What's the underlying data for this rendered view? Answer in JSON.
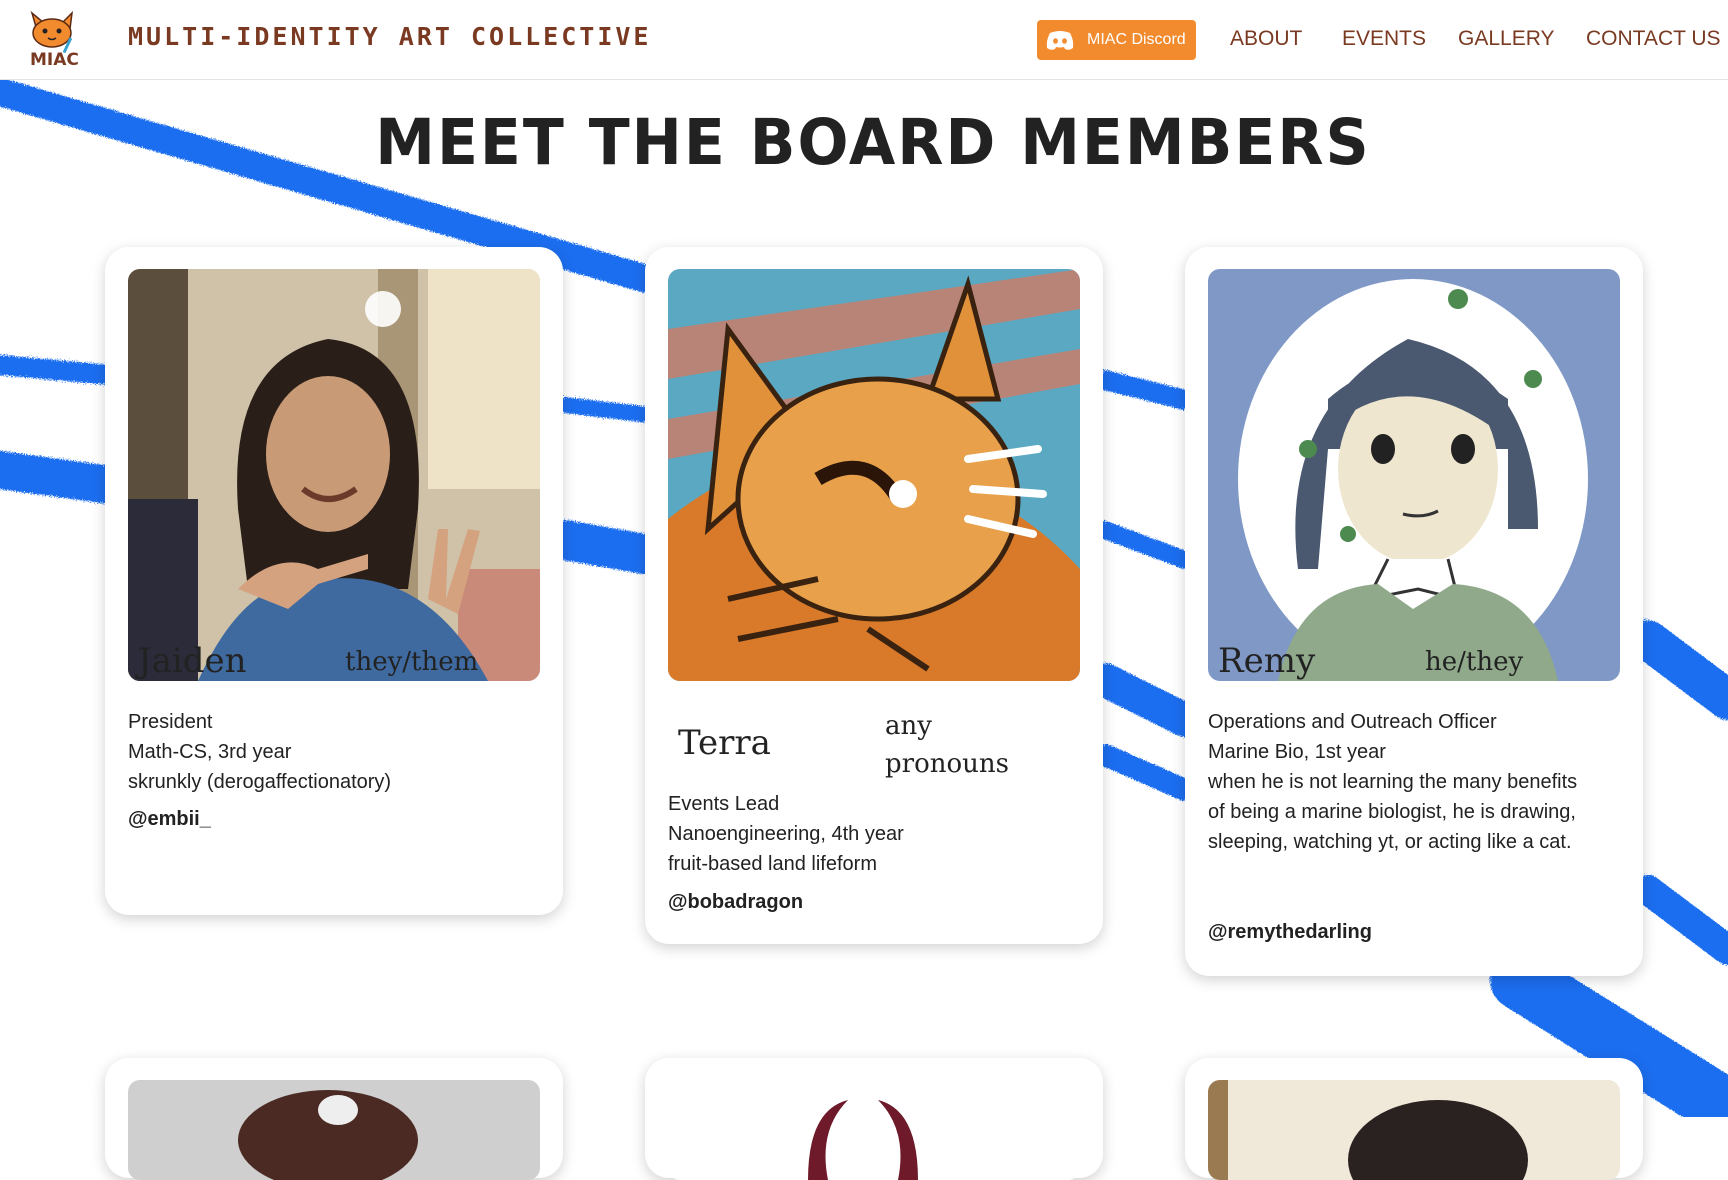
{
  "header": {
    "site_title": "Multi-identity Art Collective",
    "logo_text": "MIAC",
    "discord_label": "MIAC Discord",
    "nav": [
      "ABOUT",
      "EVENTS",
      "GALLERY",
      "CONTACT US"
    ]
  },
  "page_title": "MEET THE BOARD MEMBERS",
  "members": [
    {
      "name": "Jaiden",
      "pronouns": "they/them",
      "role": "President",
      "major": "Math-CS, 3rd year",
      "bio": "skrunkly (derogaffectionatory)",
      "handle": "@embii_"
    },
    {
      "name": "Terra",
      "pronouns_line1": "any",
      "pronouns_line2": "pronouns",
      "role": "Events Lead",
      "major": "Nanoengineering, 4th year",
      "bio": "fruit-based land lifeform",
      "handle": "@bobadragon"
    },
    {
      "name": "Remy",
      "pronouns": "he/they",
      "role": "Operations and Outreach Officer",
      "major": "Marine Bio, 1st year",
      "bio_lines": [
        "when he is not learning the many benefits",
        "of being a marine biologist, he is drawing,",
        "sleeping, watching yt, or acting like a cat."
      ],
      "handle": "@remythedarling"
    }
  ],
  "colors": {
    "accent": "#f28a2e",
    "brand_text": "#7a3a22",
    "scribble": "#1a6ef0"
  }
}
